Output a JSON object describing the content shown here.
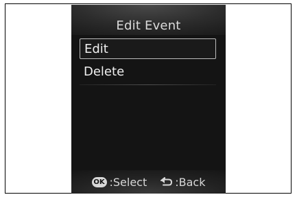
{
  "screen": {
    "title": "Edit Event",
    "menu": [
      {
        "label": "Edit",
        "selected": true
      },
      {
        "label": "Delete",
        "selected": false
      }
    ],
    "footer": {
      "ok_icon_label": "OK",
      "select_label": ":Select",
      "back_label": ":Back",
      "ok_icon": "ok-button-icon",
      "back_icon": "back-arrow-icon"
    }
  }
}
